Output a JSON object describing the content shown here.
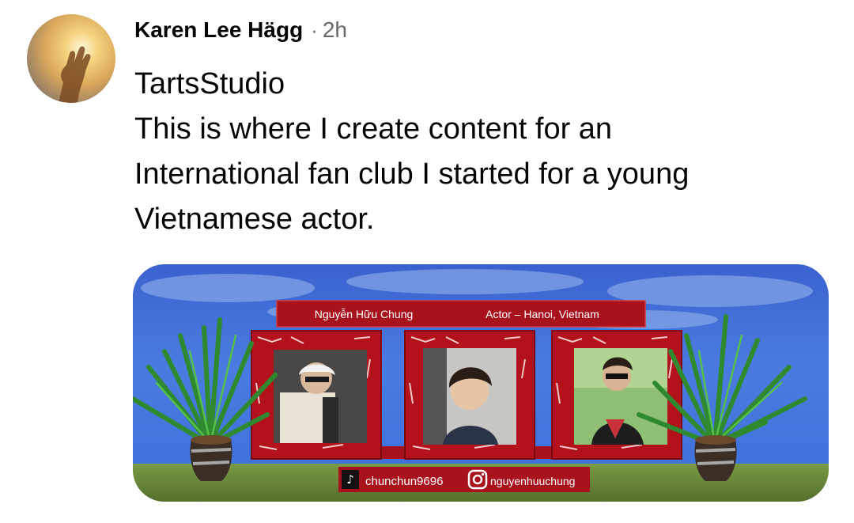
{
  "post": {
    "author": "Karen Lee Hägg",
    "separator": "·",
    "time": "2h",
    "lines": [
      "TartsStudio",
      "This is where I create content for an",
      "International fan club I started for a young",
      "Vietnamese actor."
    ]
  },
  "media": {
    "banner_name": "Nguyễn Hữu Chung",
    "banner_role": "Actor – Hanoi, Vietnam",
    "tiktok_handle": "chunchun9696",
    "instagram_handle": "nguyenhuuchung",
    "colors": {
      "sky": "#3f6ed9",
      "frame": "#b3121d",
      "grass": "#6b8a3a"
    }
  }
}
